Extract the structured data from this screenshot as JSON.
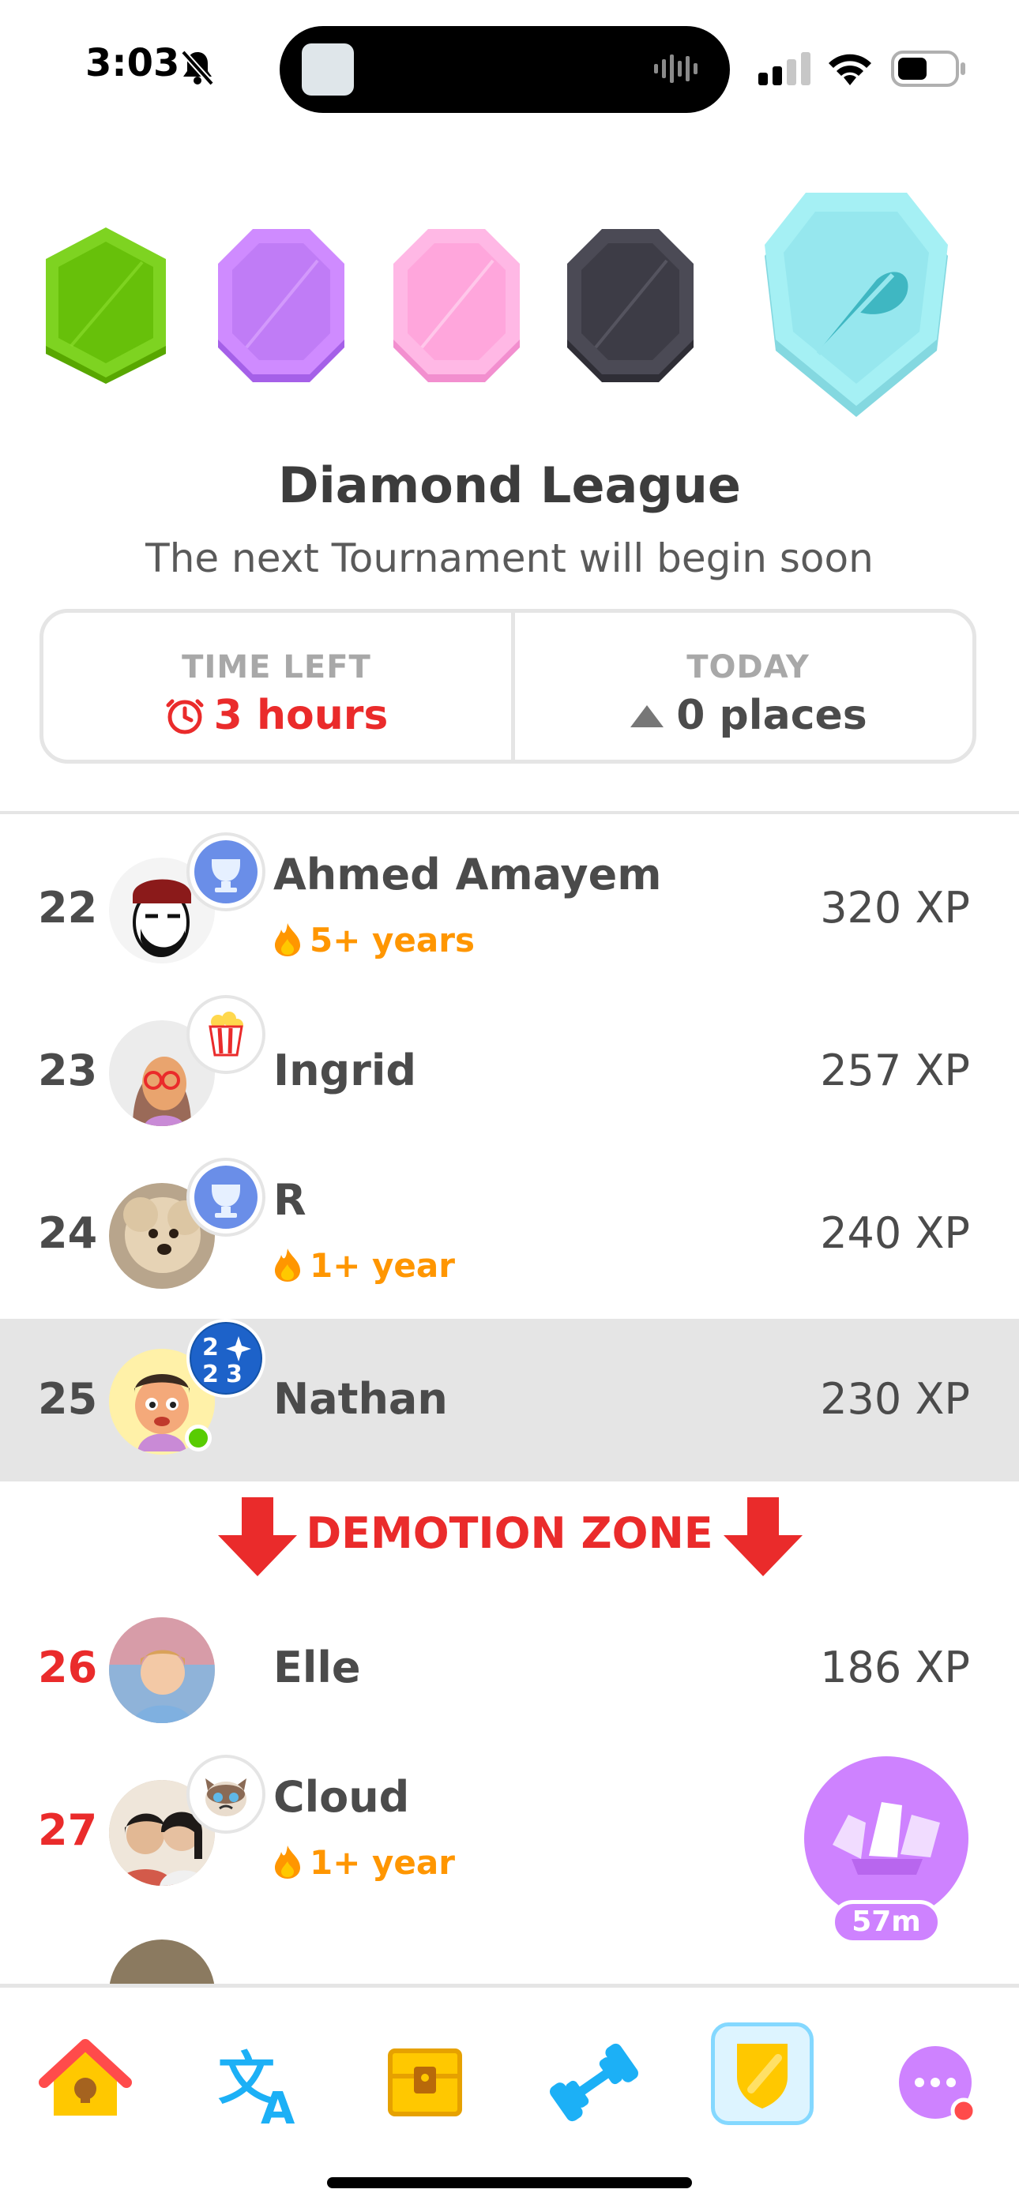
{
  "status_bar": {
    "time": "3:03"
  },
  "league": {
    "title": "Diamond League",
    "subtitle": "The next Tournament will begin soon",
    "badges": [
      "bronze-green-badge",
      "amethyst-badge",
      "pearl-pink-badge",
      "obsidian-badge",
      "diamond-badge"
    ]
  },
  "info": {
    "time_left_label": "TIME LEFT",
    "time_left_value": "3 hours",
    "today_label": "TODAY",
    "today_value": "0 places"
  },
  "leaderboard": [
    {
      "rank": "22",
      "name": "Ahmed Amayem",
      "streak": "5+ years",
      "xp": "320 XP"
    },
    {
      "rank": "23",
      "name": "Ingrid",
      "streak": "",
      "xp": "257 XP"
    },
    {
      "rank": "24",
      "name": "R",
      "streak": "1+ year",
      "xp": "240 XP"
    },
    {
      "rank": "25",
      "name": "Nathan",
      "streak": "",
      "xp": "230 XP"
    },
    {
      "rank": "26",
      "name": "Elle",
      "streak": "",
      "xp": "186 XP"
    },
    {
      "rank": "27",
      "name": "Cloud",
      "streak": "1+ year",
      "xp": ""
    }
  ],
  "demotion_zone": "DEMOTION ZONE",
  "chest_timer": "57m",
  "nav": [
    "home",
    "translate-practice",
    "treasure-chest",
    "dumbbell-practice",
    "leagues-shield",
    "more"
  ],
  "colors": {
    "red": "#ea2b2b",
    "orange": "#ff9600",
    "purple": "#ce82ff",
    "blue": "#1cb0f6",
    "diamond": "#8fe6ec"
  }
}
